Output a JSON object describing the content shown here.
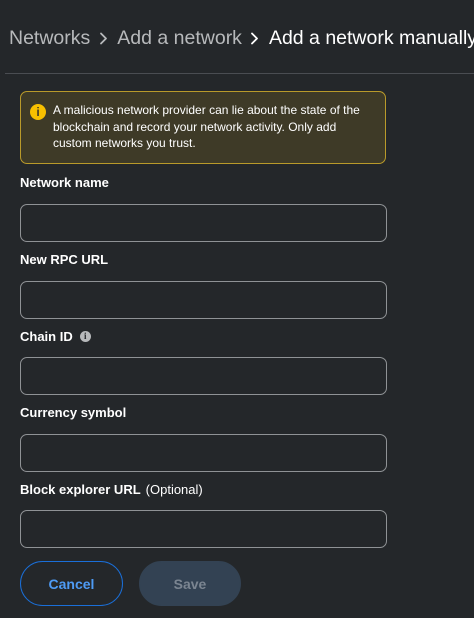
{
  "breadcrumb": {
    "items": [
      "Networks",
      "Add a network",
      "Add a network manually"
    ]
  },
  "warning": {
    "icon": "info-icon",
    "text": "A malicious network provider can lie about the state of the blockchain and record your network activity. Only add custom networks you trust."
  },
  "fields": {
    "network_name": {
      "label": "Network name",
      "value": ""
    },
    "rpc_url": {
      "label": "New RPC URL",
      "value": ""
    },
    "chain_id": {
      "label": "Chain ID",
      "value": ""
    },
    "currency_symbol": {
      "label": "Currency symbol",
      "value": ""
    },
    "block_explorer": {
      "label": "Block explorer URL",
      "optional": "(Optional)",
      "value": ""
    }
  },
  "buttons": {
    "cancel": "Cancel",
    "save": "Save"
  },
  "colors": {
    "background": "#24272a",
    "warning_bg": "#3e3a27",
    "warning_border": "#b99a2a",
    "warning_icon": "#f8c000",
    "primary": "#1a6fd9",
    "disabled_button": "#334253"
  }
}
